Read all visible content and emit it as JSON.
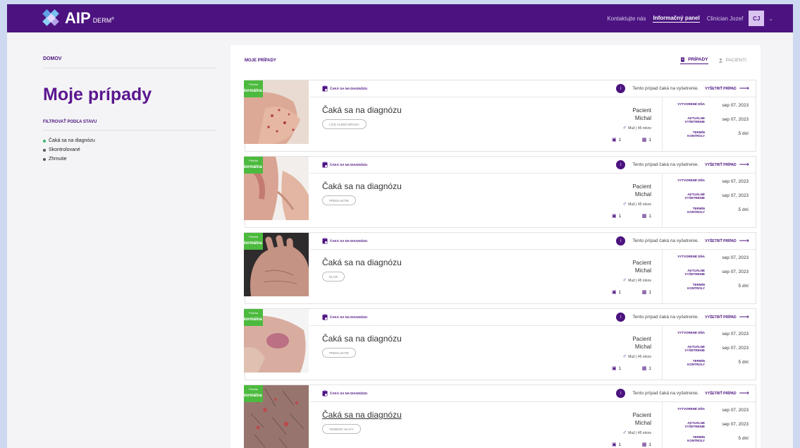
{
  "header": {
    "logo_text": "AIP",
    "logo_sub": "DERM",
    "logo_mark": "®",
    "nav": [
      "Kontaktujte nás",
      "Informačný panel",
      "Clinician Jozef"
    ],
    "avatar_initials": "CJ",
    "brand_color": "#4c1380"
  },
  "sidebar": {
    "breadcrumb": "DOMOV",
    "title": "Moje prípady",
    "filter_title": "FILTROVAŤ PODĽA STAVU",
    "filters": [
      "Čaká sa na diagnózu",
      "Skontrolované",
      "Zhrnutie"
    ],
    "selected_filter": "Čaká sa na diagnózu"
  },
  "panel": {
    "title": "MOJE PRÍPADY",
    "tabs": [
      {
        "label": "PRÍPADY",
        "icon": "document-icon",
        "active": true
      },
      {
        "label": "PACIENTI",
        "icon": "person-icon",
        "active": false
      }
    ]
  },
  "labels": {
    "priority_top": "Priorita",
    "priority": "Normálna",
    "status": "ČAKÁ SA NA DIAGNÓZU",
    "message": "Tento prípad čaká na vyšetrenie.",
    "exam_button": "VYŠETRIŤ PRÍPAD",
    "case_title": "Čaká sa na diagnózu",
    "created": "VYTVORENÉ DŇA",
    "current_exam": "AKTUÁLNE VYŠETRENIE",
    "followup": "TERMÍN KONTROLY"
  },
  "cases": [
    {
      "location": "LÍCE ALEBO BRADA",
      "patient_first": "Pacient",
      "patient_last": "Michal",
      "sex_age": "Muž | 45 rokov",
      "lesions": "1",
      "images": "1",
      "created": "sep 07, 2023",
      "exam": "sep 07, 2023",
      "followup": "5 dní"
    },
    {
      "location": "PREDLAKTIE",
      "patient_first": "Pacient",
      "patient_last": "Michal",
      "sex_age": "Muž | 45 rokov",
      "lesions": "1",
      "images": "1",
      "created": "sep 07, 2023",
      "exam": "sep 07, 2023",
      "followup": "5 dní"
    },
    {
      "location": "DLAŇ",
      "patient_first": "Pacient",
      "patient_last": "Michal",
      "sex_age": "Muž | 45 rokov",
      "lesions": "1",
      "images": "1",
      "created": "sep 07, 2023",
      "exam": "sep 07, 2023",
      "followup": "5 dní"
    },
    {
      "location": "PREDLAKTIE",
      "patient_first": "Pacient",
      "patient_last": "Michal",
      "sex_age": "Muž | 45 rokov",
      "lesions": "1",
      "images": "1",
      "created": "sep 07, 2023",
      "exam": "sep 07, 2023",
      "followup": "5 dní"
    },
    {
      "location": "TEMENO HLAVY",
      "patient_first": "Pacient",
      "patient_last": "Michal",
      "sex_age": "Muž | 45 rokov",
      "lesions": "1",
      "images": "1",
      "created": "sep 07, 2023",
      "exam": "sep 07, 2023",
      "followup": "5 dní"
    }
  ]
}
